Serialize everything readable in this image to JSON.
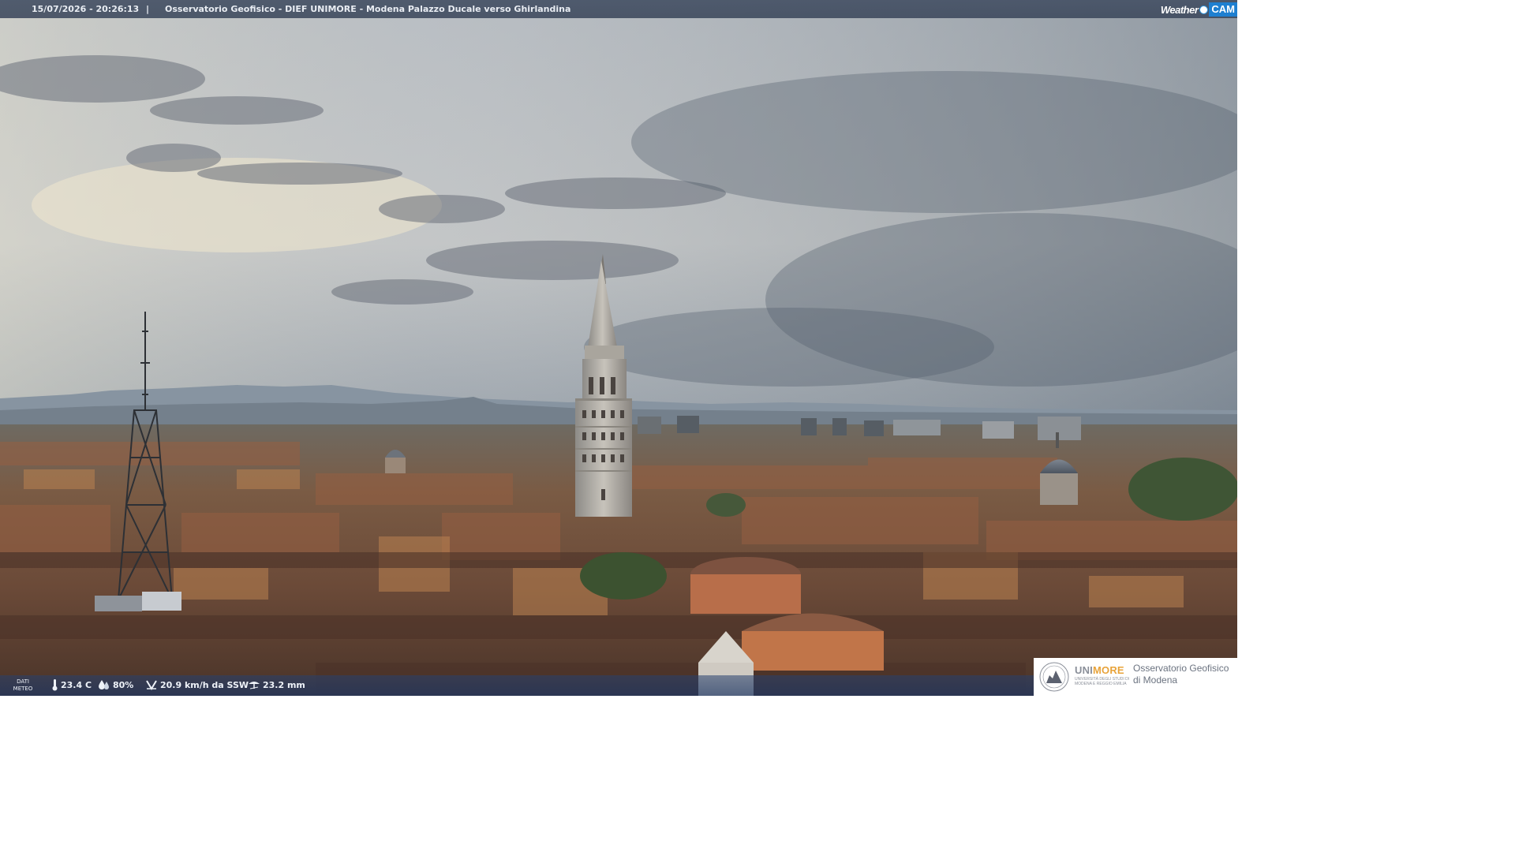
{
  "header": {
    "timestamp": "15/07/2026 - 20:26:13",
    "separator": "|",
    "title": "Osservatorio Geofisico - DIEF UNIMORE - Modena Palazzo Ducale verso Ghirlandina"
  },
  "brand": {
    "weather_text": "Weather",
    "cam_text": "CAM",
    "accent": "#1e7fd0"
  },
  "weather": {
    "label_line1": "DATI",
    "label_line2": "METEO",
    "temperature": "23.4 C",
    "humidity": "80%",
    "wind": "20.9 km/h da SSW",
    "rain": "23.2 mm",
    "icons": [
      "thermometer-icon",
      "humidity-drop-icon",
      "wind-icon",
      "rain-icon"
    ]
  },
  "footer_logo": {
    "uni": "UNI",
    "more": "MORE",
    "sub": "Università degli studi di Modena e Reggio Emilia",
    "observatory_line1": "Osservatorio Geofisico",
    "observatory_line2": "di Modena",
    "accent": "#e8a33a"
  }
}
